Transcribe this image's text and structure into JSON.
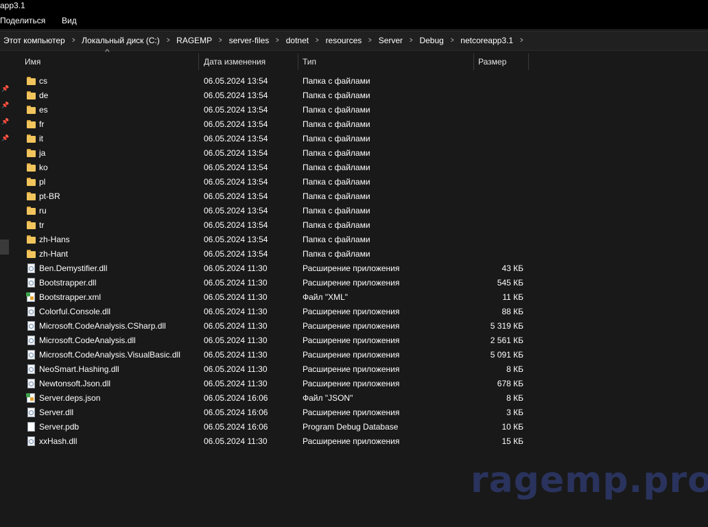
{
  "window": {
    "title": "app3.1"
  },
  "ribbon": {
    "share": "Поделиться",
    "view": "Вид"
  },
  "breadcrumb": [
    "Этот компьютер",
    "Локальный диск (C:)",
    "RAGEMP",
    "server-files",
    "dotnet",
    "resources",
    "Server",
    "Debug",
    "netcoreapp3.1"
  ],
  "breadcrumb_sep": ">",
  "columns": {
    "name": "Имя",
    "date": "Дата изменения",
    "type": "Тип",
    "size": "Размер"
  },
  "sort_arrow": "^",
  "files": [
    {
      "icon": "folder-icon",
      "name": "cs",
      "date": "06.05.2024 13:54",
      "type": "Папка с файлами",
      "size": ""
    },
    {
      "icon": "folder-icon",
      "name": "de",
      "date": "06.05.2024 13:54",
      "type": "Папка с файлами",
      "size": ""
    },
    {
      "icon": "folder-icon",
      "name": "es",
      "date": "06.05.2024 13:54",
      "type": "Папка с файлами",
      "size": ""
    },
    {
      "icon": "folder-icon",
      "name": "fr",
      "date": "06.05.2024 13:54",
      "type": "Папка с файлами",
      "size": ""
    },
    {
      "icon": "folder-icon",
      "name": "it",
      "date": "06.05.2024 13:54",
      "type": "Папка с файлами",
      "size": ""
    },
    {
      "icon": "folder-icon",
      "name": "ja",
      "date": "06.05.2024 13:54",
      "type": "Папка с файлами",
      "size": ""
    },
    {
      "icon": "folder-icon",
      "name": "ko",
      "date": "06.05.2024 13:54",
      "type": "Папка с файлами",
      "size": ""
    },
    {
      "icon": "folder-icon",
      "name": "pl",
      "date": "06.05.2024 13:54",
      "type": "Папка с файлами",
      "size": ""
    },
    {
      "icon": "folder-icon",
      "name": "pt-BR",
      "date": "06.05.2024 13:54",
      "type": "Папка с файлами",
      "size": ""
    },
    {
      "icon": "folder-icon",
      "name": "ru",
      "date": "06.05.2024 13:54",
      "type": "Папка с файлами",
      "size": ""
    },
    {
      "icon": "folder-icon",
      "name": "tr",
      "date": "06.05.2024 13:54",
      "type": "Папка с файлами",
      "size": ""
    },
    {
      "icon": "folder-icon",
      "name": "zh-Hans",
      "date": "06.05.2024 13:54",
      "type": "Папка с файлами",
      "size": ""
    },
    {
      "icon": "folder-icon",
      "name": "zh-Hant",
      "date": "06.05.2024 13:54",
      "type": "Папка с файлами",
      "size": ""
    },
    {
      "icon": "dll-file-icon",
      "name": "Ben.Demystifier.dll",
      "date": "06.05.2024 11:30",
      "type": "Расширение приложения",
      "size": "43 КБ"
    },
    {
      "icon": "dll-file-icon",
      "name": "Bootstrapper.dll",
      "date": "06.05.2024 11:30",
      "type": "Расширение приложения",
      "size": "545 КБ"
    },
    {
      "icon": "xml-file-icon",
      "name": "Bootstrapper.xml",
      "date": "06.05.2024 11:30",
      "type": "Файл \"XML\"",
      "size": "11 КБ"
    },
    {
      "icon": "dll-file-icon",
      "name": "Colorful.Console.dll",
      "date": "06.05.2024 11:30",
      "type": "Расширение приложения",
      "size": "88 КБ"
    },
    {
      "icon": "dll-file-icon",
      "name": "Microsoft.CodeAnalysis.CSharp.dll",
      "date": "06.05.2024 11:30",
      "type": "Расширение приложения",
      "size": "5 319 КБ"
    },
    {
      "icon": "dll-file-icon",
      "name": "Microsoft.CodeAnalysis.dll",
      "date": "06.05.2024 11:30",
      "type": "Расширение приложения",
      "size": "2 561 КБ"
    },
    {
      "icon": "dll-file-icon",
      "name": "Microsoft.CodeAnalysis.VisualBasic.dll",
      "date": "06.05.2024 11:30",
      "type": "Расширение приложения",
      "size": "5 091 КБ"
    },
    {
      "icon": "dll-file-icon",
      "name": "NeoSmart.Hashing.dll",
      "date": "06.05.2024 11:30",
      "type": "Расширение приложения",
      "size": "8 КБ"
    },
    {
      "icon": "dll-file-icon",
      "name": "Newtonsoft.Json.dll",
      "date": "06.05.2024 11:30",
      "type": "Расширение приложения",
      "size": "678 КБ"
    },
    {
      "icon": "json-file-icon",
      "name": "Server.deps.json",
      "date": "06.05.2024 16:06",
      "type": "Файл \"JSON\"",
      "size": "8 КБ"
    },
    {
      "icon": "dll-file-icon",
      "name": "Server.dll",
      "date": "06.05.2024 16:06",
      "type": "Расширение приложения",
      "size": "3 КБ"
    },
    {
      "icon": "blank-file-icon",
      "name": "Server.pdb",
      "date": "06.05.2024 16:06",
      "type": "Program Debug Database",
      "size": "10 КБ"
    },
    {
      "icon": "dll-file-icon",
      "name": "xxHash.dll",
      "date": "06.05.2024 11:30",
      "type": "Расширение приложения",
      "size": "15 КБ"
    }
  ],
  "watermark": "ragemp.pro",
  "colors": {
    "background": "#191919",
    "folder": "#f2c55c",
    "watermark": "#2b3561"
  }
}
